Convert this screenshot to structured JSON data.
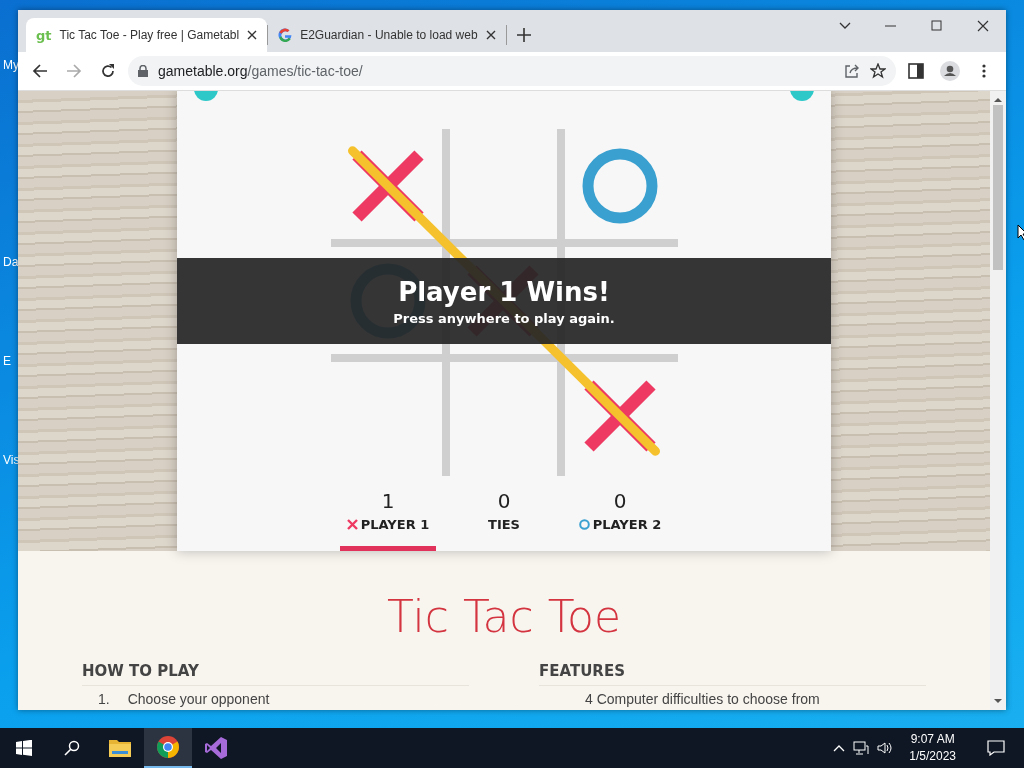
{
  "desktop": {
    "icon_labels": [
      "My",
      "Da",
      "E",
      "Vis"
    ]
  },
  "browser": {
    "tabs": [
      {
        "favicon": "gt",
        "title": "Tic Tac Toe - Play free | Gametabl",
        "selected": true
      },
      {
        "title": "E2Guardian - Unable to load web",
        "selected": false
      }
    ],
    "url_host": "gametable.org",
    "url_path": "/games/tic-tac-toe/"
  },
  "game": {
    "cells": [
      {
        "kind": "x"
      },
      {
        "kind": "empty"
      },
      {
        "kind": "o"
      },
      {
        "kind": "o"
      },
      {
        "kind": "x"
      },
      {
        "kind": "empty"
      },
      {
        "kind": "empty"
      },
      {
        "kind": "empty"
      },
      {
        "kind": "x"
      }
    ],
    "win_line": {
      "kind": "diagonal"
    },
    "win_message": "Player 1 Wins!",
    "win_hint": "Press anywhere to play again.",
    "scores": [
      {
        "value": "1",
        "label": "PLAYER 1",
        "kind": "x",
        "selected": true
      },
      {
        "value": "0",
        "label": "TIES",
        "kind": "plain",
        "selected": false
      },
      {
        "value": "0",
        "label": "PLAYER 2",
        "kind": "o",
        "selected": false
      }
    ]
  },
  "page": {
    "title": "Tic Tac Toe",
    "columns": [
      {
        "heading": "HOW TO PLAY",
        "item_number": "1.",
        "item": "Choose your opponent"
      },
      {
        "heading": "FEATURES",
        "item": "4 Computer difficulties to choose from"
      }
    ]
  },
  "taskbar": {
    "apps": [
      {
        "kind": "folder",
        "selected": false
      },
      {
        "kind": "chrome",
        "selected": true
      },
      {
        "kind": "studio",
        "selected": false
      }
    ],
    "time": "9:07 AM",
    "date": "1/5/2023"
  }
}
